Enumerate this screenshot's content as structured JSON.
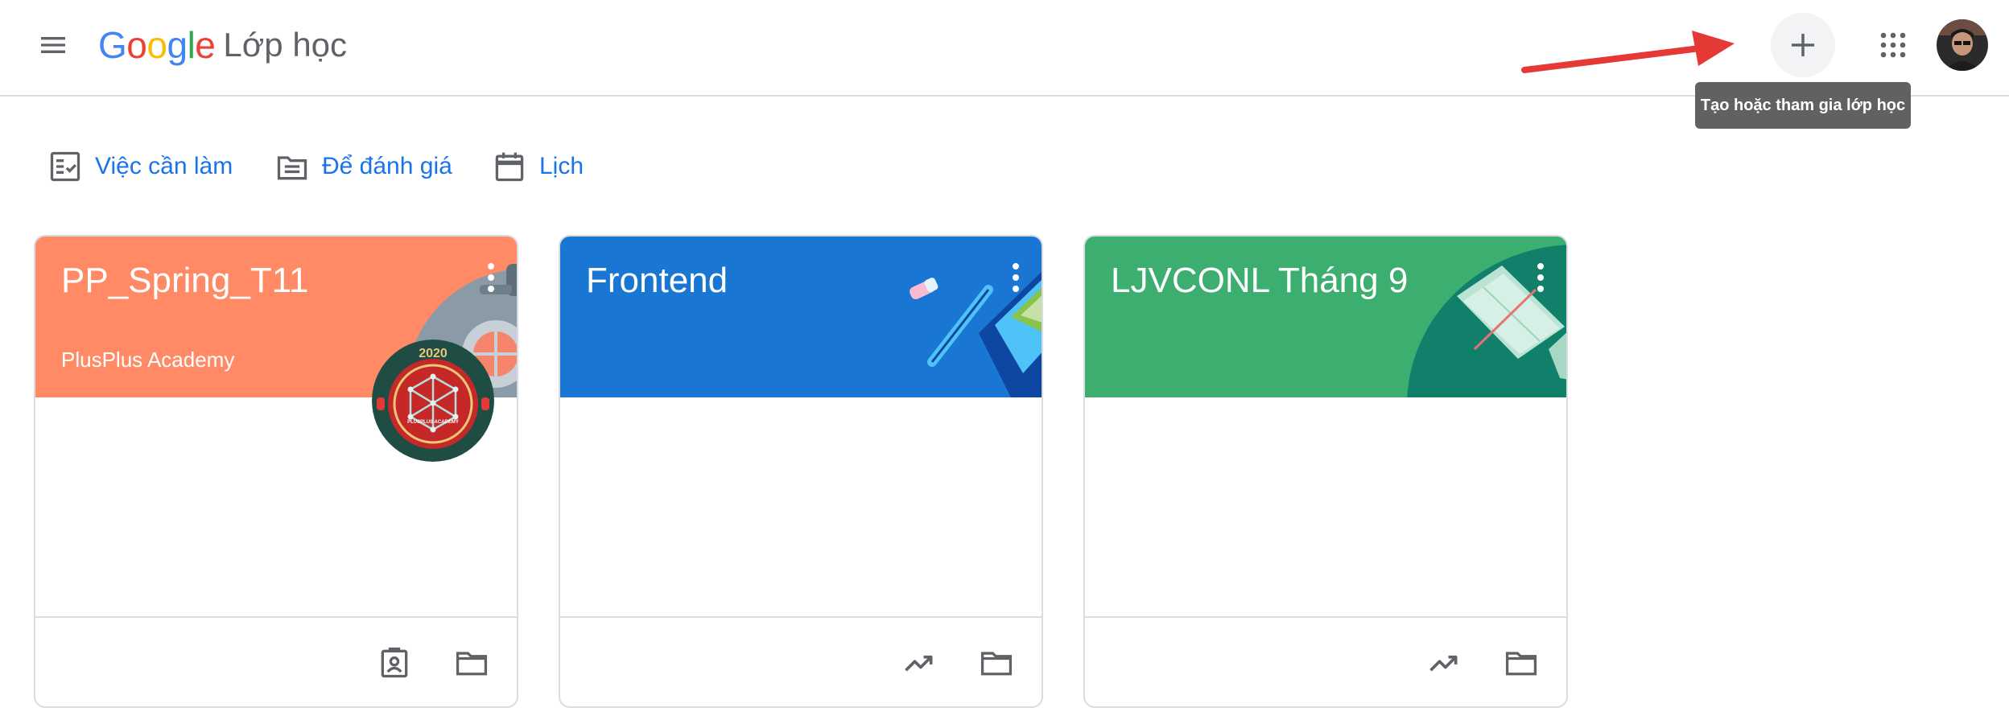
{
  "header": {
    "logo": {
      "letters": [
        "G",
        "o",
        "o",
        "g",
        "l",
        "e"
      ],
      "colors": [
        "#4285F4",
        "#EA4335",
        "#FBBC05",
        "#4285F4",
        "#34A853",
        "#EA4335"
      ]
    },
    "product_name": "Lớp học",
    "create_tooltip": "Tạo hoặc tham gia lớp học",
    "icons": [
      "menu-icon",
      "plus-icon",
      "apps-grid-icon",
      "avatar"
    ]
  },
  "quick_links": [
    {
      "label": "Việc cần làm",
      "icon": "checklist-icon"
    },
    {
      "label": "Để đánh giá",
      "icon": "review-folder-icon"
    },
    {
      "label": "Lịch",
      "icon": "calendar-icon"
    }
  ],
  "cards": [
    {
      "title": "PP_Spring_T11",
      "subtitle": "PlusPlus Academy",
      "header_color": "#ff8a65",
      "avatar_text": "PLUSPLUS ACADEMY",
      "avatar_year": "2020",
      "footer_icons": [
        "assignment-ind-icon",
        "folder-icon"
      ]
    },
    {
      "title": "Frontend",
      "subtitle": "",
      "header_color": "#1976d2",
      "footer_icons": [
        "trending-up-icon",
        "folder-icon"
      ]
    },
    {
      "title": "LJVCONL Tháng 9",
      "subtitle": "",
      "header_color": "#3cae70",
      "footer_icons": [
        "trending-up-icon",
        "folder-icon"
      ]
    }
  ],
  "colors": {
    "accent": "#1a73e8",
    "arrow": "#e53935"
  }
}
